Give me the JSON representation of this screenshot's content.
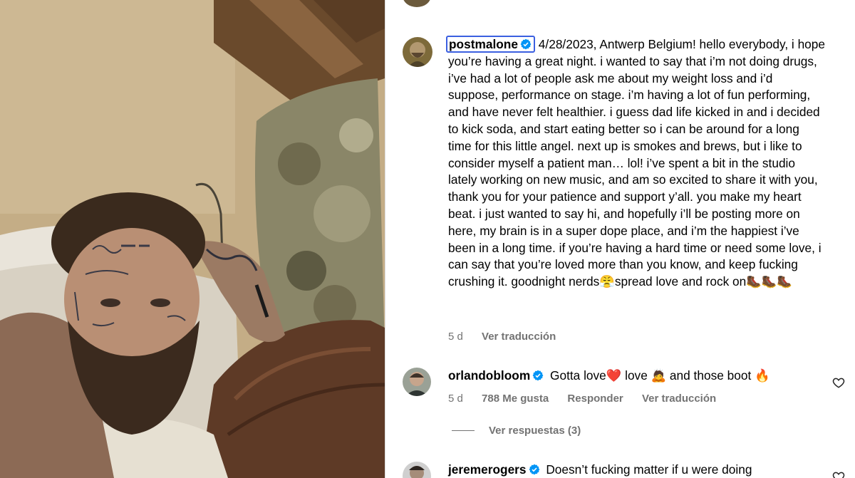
{
  "caption": {
    "username": "postmalone",
    "text": "4/28/2023, Antwerp Belgium! hello everybody, i hope you’re having a great night. i wanted to say that i’m not doing drugs, i’ve had a lot of people ask me about my weight loss and i’d suppose, performance on stage. i’m having a lot of fun performing, and have never felt healthier. i guess dad life kicked in and i decided to kick soda, and start eating better so i can be around for a long time for this little angel. next up is smokes and brews, but i like to consider myself a patient man… lol! i’ve spent a bit in the studio lately working on new music, and am so excited to share it with you, thank you for your patience and support y’all. you make my heart beat. i just wanted to say hi, and hopefully i’ll be posting more on here, my brain is in a super dope place, and i’m the happiest i’ve been in a long time. if you’re having a hard time or need some love, i can say that you’re loved more than you know, and keep fucking crushing it. goodnight nerds😤spread love and rock on🥾🥾🥾",
    "time": "5 d",
    "translate": "Ver traducción"
  },
  "comments": [
    {
      "username": "orlandobloom",
      "text": "Gotta love❤️ love 🙇 and those boot 🔥",
      "time": "5 d",
      "likes": "788 Me gusta",
      "reply": "Responder",
      "translate": "Ver traducción",
      "view_replies": "Ver respuestas (3)"
    },
    {
      "username": "jeremerogers",
      "text": "Doesn’t fucking matter if u were doing"
    }
  ],
  "icons": {
    "verified": "verified-badge-icon",
    "heart": "heart-outline-icon"
  },
  "colors": {
    "verified": "#0095f6",
    "secondary_text": "#737373",
    "focus_outline": "#3b5fe0"
  }
}
